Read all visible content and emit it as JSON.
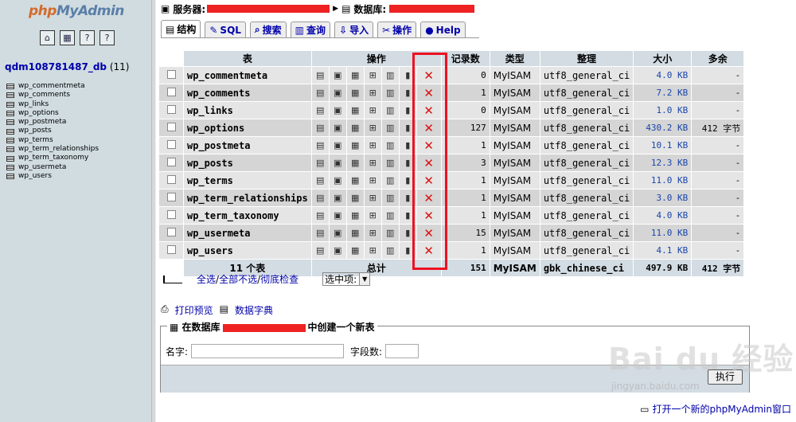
{
  "sidebar": {
    "logo_php": "php",
    "logo_myadmin": "MyAdmin",
    "db_name": "qdm108781487_db",
    "db_count": "(11)",
    "tables": [
      "wp_commentmeta",
      "wp_comments",
      "wp_links",
      "wp_options",
      "wp_postmeta",
      "wp_posts",
      "wp_terms",
      "wp_term_relationships",
      "wp_term_taxonomy",
      "wp_usermeta",
      "wp_users"
    ]
  },
  "breadcrumb": {
    "server_label": "服务器:",
    "db_label": "数据库:"
  },
  "tabs": [
    "结构",
    "SQL",
    "搜索",
    "查询",
    "导入",
    "操作",
    "Help"
  ],
  "table": {
    "headers": {
      "table": "表",
      "ops": "操作",
      "records": "记录数",
      "type": "类型",
      "collation": "整理",
      "size": "大小",
      "overhead": "多余"
    },
    "rows": [
      {
        "name": "wp_commentmeta",
        "records": "0",
        "type": "MyISAM",
        "collation": "utf8_general_ci",
        "size": "4.0 KB",
        "overhead": "-"
      },
      {
        "name": "wp_comments",
        "records": "1",
        "type": "MyISAM",
        "collation": "utf8_general_ci",
        "size": "7.2 KB",
        "overhead": "-"
      },
      {
        "name": "wp_links",
        "records": "0",
        "type": "MyISAM",
        "collation": "utf8_general_ci",
        "size": "1.0 KB",
        "overhead": "-"
      },
      {
        "name": "wp_options",
        "records": "127",
        "type": "MyISAM",
        "collation": "utf8_general_ci",
        "size": "430.2 KB",
        "overhead": "412 字节"
      },
      {
        "name": "wp_postmeta",
        "records": "1",
        "type": "MyISAM",
        "collation": "utf8_general_ci",
        "size": "10.1 KB",
        "overhead": "-"
      },
      {
        "name": "wp_posts",
        "records": "3",
        "type": "MyISAM",
        "collation": "utf8_general_ci",
        "size": "12.3 KB",
        "overhead": "-"
      },
      {
        "name": "wp_terms",
        "records": "1",
        "type": "MyISAM",
        "collation": "utf8_general_ci",
        "size": "11.0 KB",
        "overhead": "-"
      },
      {
        "name": "wp_term_relationships",
        "records": "1",
        "type": "MyISAM",
        "collation": "utf8_general_ci",
        "size": "3.0 KB",
        "overhead": "-"
      },
      {
        "name": "wp_term_taxonomy",
        "records": "1",
        "type": "MyISAM",
        "collation": "utf8_general_ci",
        "size": "4.0 KB",
        "overhead": "-"
      },
      {
        "name": "wp_usermeta",
        "records": "15",
        "type": "MyISAM",
        "collation": "utf8_general_ci",
        "size": "11.0 KB",
        "overhead": "-"
      },
      {
        "name": "wp_users",
        "records": "1",
        "type": "MyISAM",
        "collation": "utf8_general_ci",
        "size": "4.1 KB",
        "overhead": "-"
      }
    ],
    "total": {
      "name": "11 个表",
      "ops": "总计",
      "records": "151",
      "type": "MyISAM",
      "collation": "gbk_chinese_ci",
      "size": "497.9 KB",
      "overhead": "412 字节"
    }
  },
  "selection": {
    "check_all": "全选",
    "uncheck_all": "全部不选",
    "check_overhead": "彻底检查",
    "with_selected": "选中项:",
    "sep": " / "
  },
  "links": {
    "print": "打印预览",
    "dict": "数据字典"
  },
  "new_table": {
    "legend_prefix": "在数据库",
    "legend_suffix": "中创建一个新表",
    "name_label": "名字:",
    "fields_label": "字段数:",
    "go": "执行"
  },
  "bottom_link": "打开一个新的phpMyAdmin窗口",
  "watermark": {
    "main": "Bai du 经验",
    "sub": "jingyan.baidu.com"
  }
}
